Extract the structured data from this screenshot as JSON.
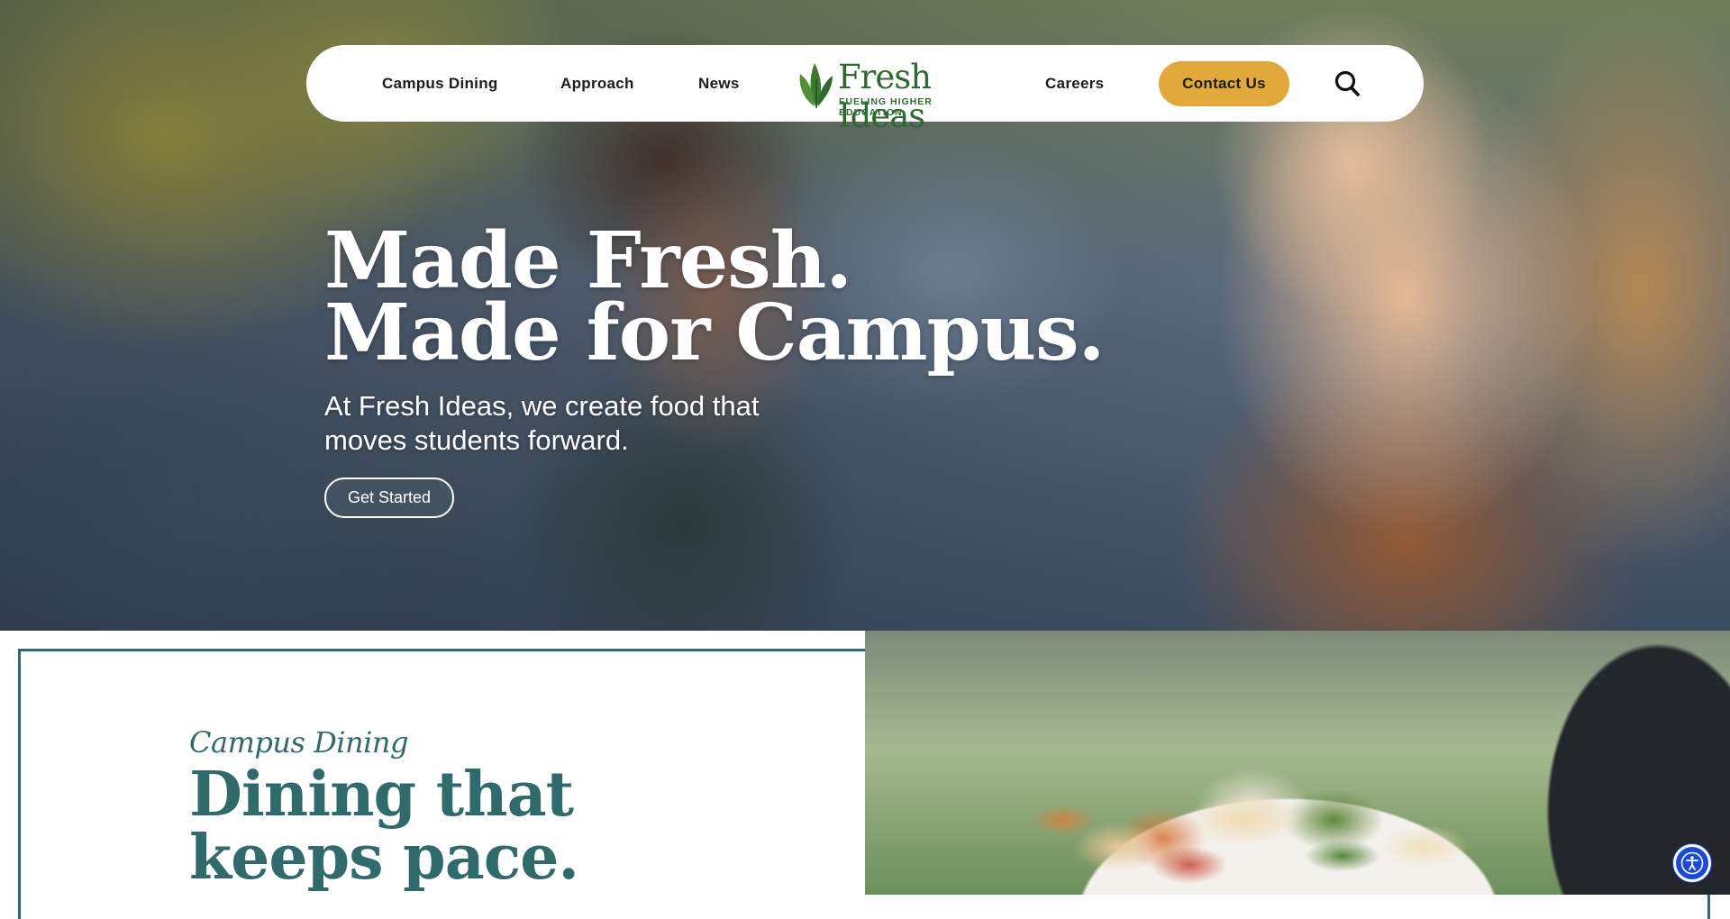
{
  "nav": {
    "items": [
      "Campus Dining",
      "Approach",
      "News",
      "Careers"
    ],
    "logo": {
      "wordmark": "Fresh Ideas",
      "tagline": "FUELING HIGHER EDUCATION"
    },
    "contact_label": "Contact Us",
    "search_icon": "search-icon"
  },
  "hero": {
    "headline_line1": "Made Fresh.",
    "headline_line2": "Made for Campus.",
    "subheading": "At Fresh Ideas, we create food that moves students forward.",
    "cta_label": "Get Started"
  },
  "dining": {
    "eyebrow": "Campus Dining",
    "title": "Dining that keeps pace."
  },
  "colors": {
    "brand_green": "#2e6a30",
    "accent_gold": "#e0a93a",
    "teal": "#2f6b6b",
    "a11y_blue": "#1a4bd8"
  },
  "icons": {
    "accessibility": "accessibility-icon",
    "logo_leaf": "leaf-icon"
  }
}
